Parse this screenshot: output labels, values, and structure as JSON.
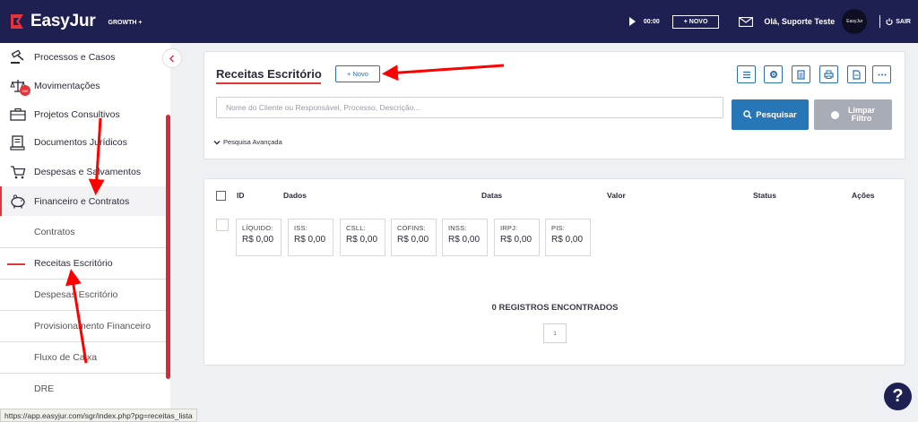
{
  "topbar": {
    "brand": "EasyJur",
    "plan": "GROWTH +",
    "timer": "00:00",
    "new_button": "+ NOVO",
    "greeting": "Olá, Suporte Teste",
    "avatar_text": "EasyJur",
    "logout": "SAIR"
  },
  "sidebar": {
    "items": [
      {
        "label": "Processos e Casos",
        "icon": "gavel-icon"
      },
      {
        "label": "Movimentações",
        "icon": "scales-icon",
        "badge": "999"
      },
      {
        "label": "Projetos Consultivos",
        "icon": "briefcase-icon"
      },
      {
        "label": "Documentos Jurídicos",
        "icon": "document-icon"
      },
      {
        "label": "Despesas e Salvamentos",
        "icon": "cart-icon"
      },
      {
        "label": "Financeiro e Contratos",
        "icon": "piggy-bank-icon"
      }
    ],
    "subitems": [
      {
        "label": "Contratos"
      },
      {
        "label": "Receitas Escritório",
        "active": true
      },
      {
        "label": "Despesas Escritório"
      },
      {
        "label": "Provisionamento Financeiro"
      },
      {
        "label": "Fluxo de Caixa"
      },
      {
        "label": "DRE"
      }
    ]
  },
  "status_url": "https://app.easyjur.com/sgr/index.php?pg=receitas_lista",
  "filter": {
    "title": "Receitas Escritório",
    "new_button": "+ Novo",
    "search_placeholder": "Nome do Cliente ou Responsável, Processo, Descrição...",
    "search_button": "Pesquisar",
    "clear_button_line1": "Limpar",
    "clear_button_line2": "Filtro",
    "advanced": "Pesquisa Avançada",
    "tools": [
      "columns-icon",
      "gear-icon",
      "spreadsheet-icon",
      "printer-icon",
      "pdf-icon",
      "more-icon"
    ]
  },
  "table": {
    "headers": {
      "id": "ID",
      "dados": "Dados",
      "datas": "Datas",
      "valor": "Valor",
      "status": "Status",
      "acoes": "Ações"
    },
    "totals": [
      {
        "label": "LÍQUIDO:",
        "value": "R$ 0,00"
      },
      {
        "label": "ISS:",
        "value": "R$ 0,00"
      },
      {
        "label": "CSLL:",
        "value": "R$ 0,00"
      },
      {
        "label": "COFINS:",
        "value": "R$ 0,00"
      },
      {
        "label": "INSS:",
        "value": "R$ 0,00"
      },
      {
        "label": "IRPJ:",
        "value": "R$ 0,00"
      },
      {
        "label": "PIS:",
        "value": "R$ 0,00"
      }
    ],
    "empty_message": "0 REGISTROS ENCONTRADOS",
    "page": "1"
  },
  "colors": {
    "navy": "#1f2052",
    "accent_red": "#e5333a",
    "primary_blue": "#2777b8",
    "annotation_arrow": "#ff0000"
  }
}
